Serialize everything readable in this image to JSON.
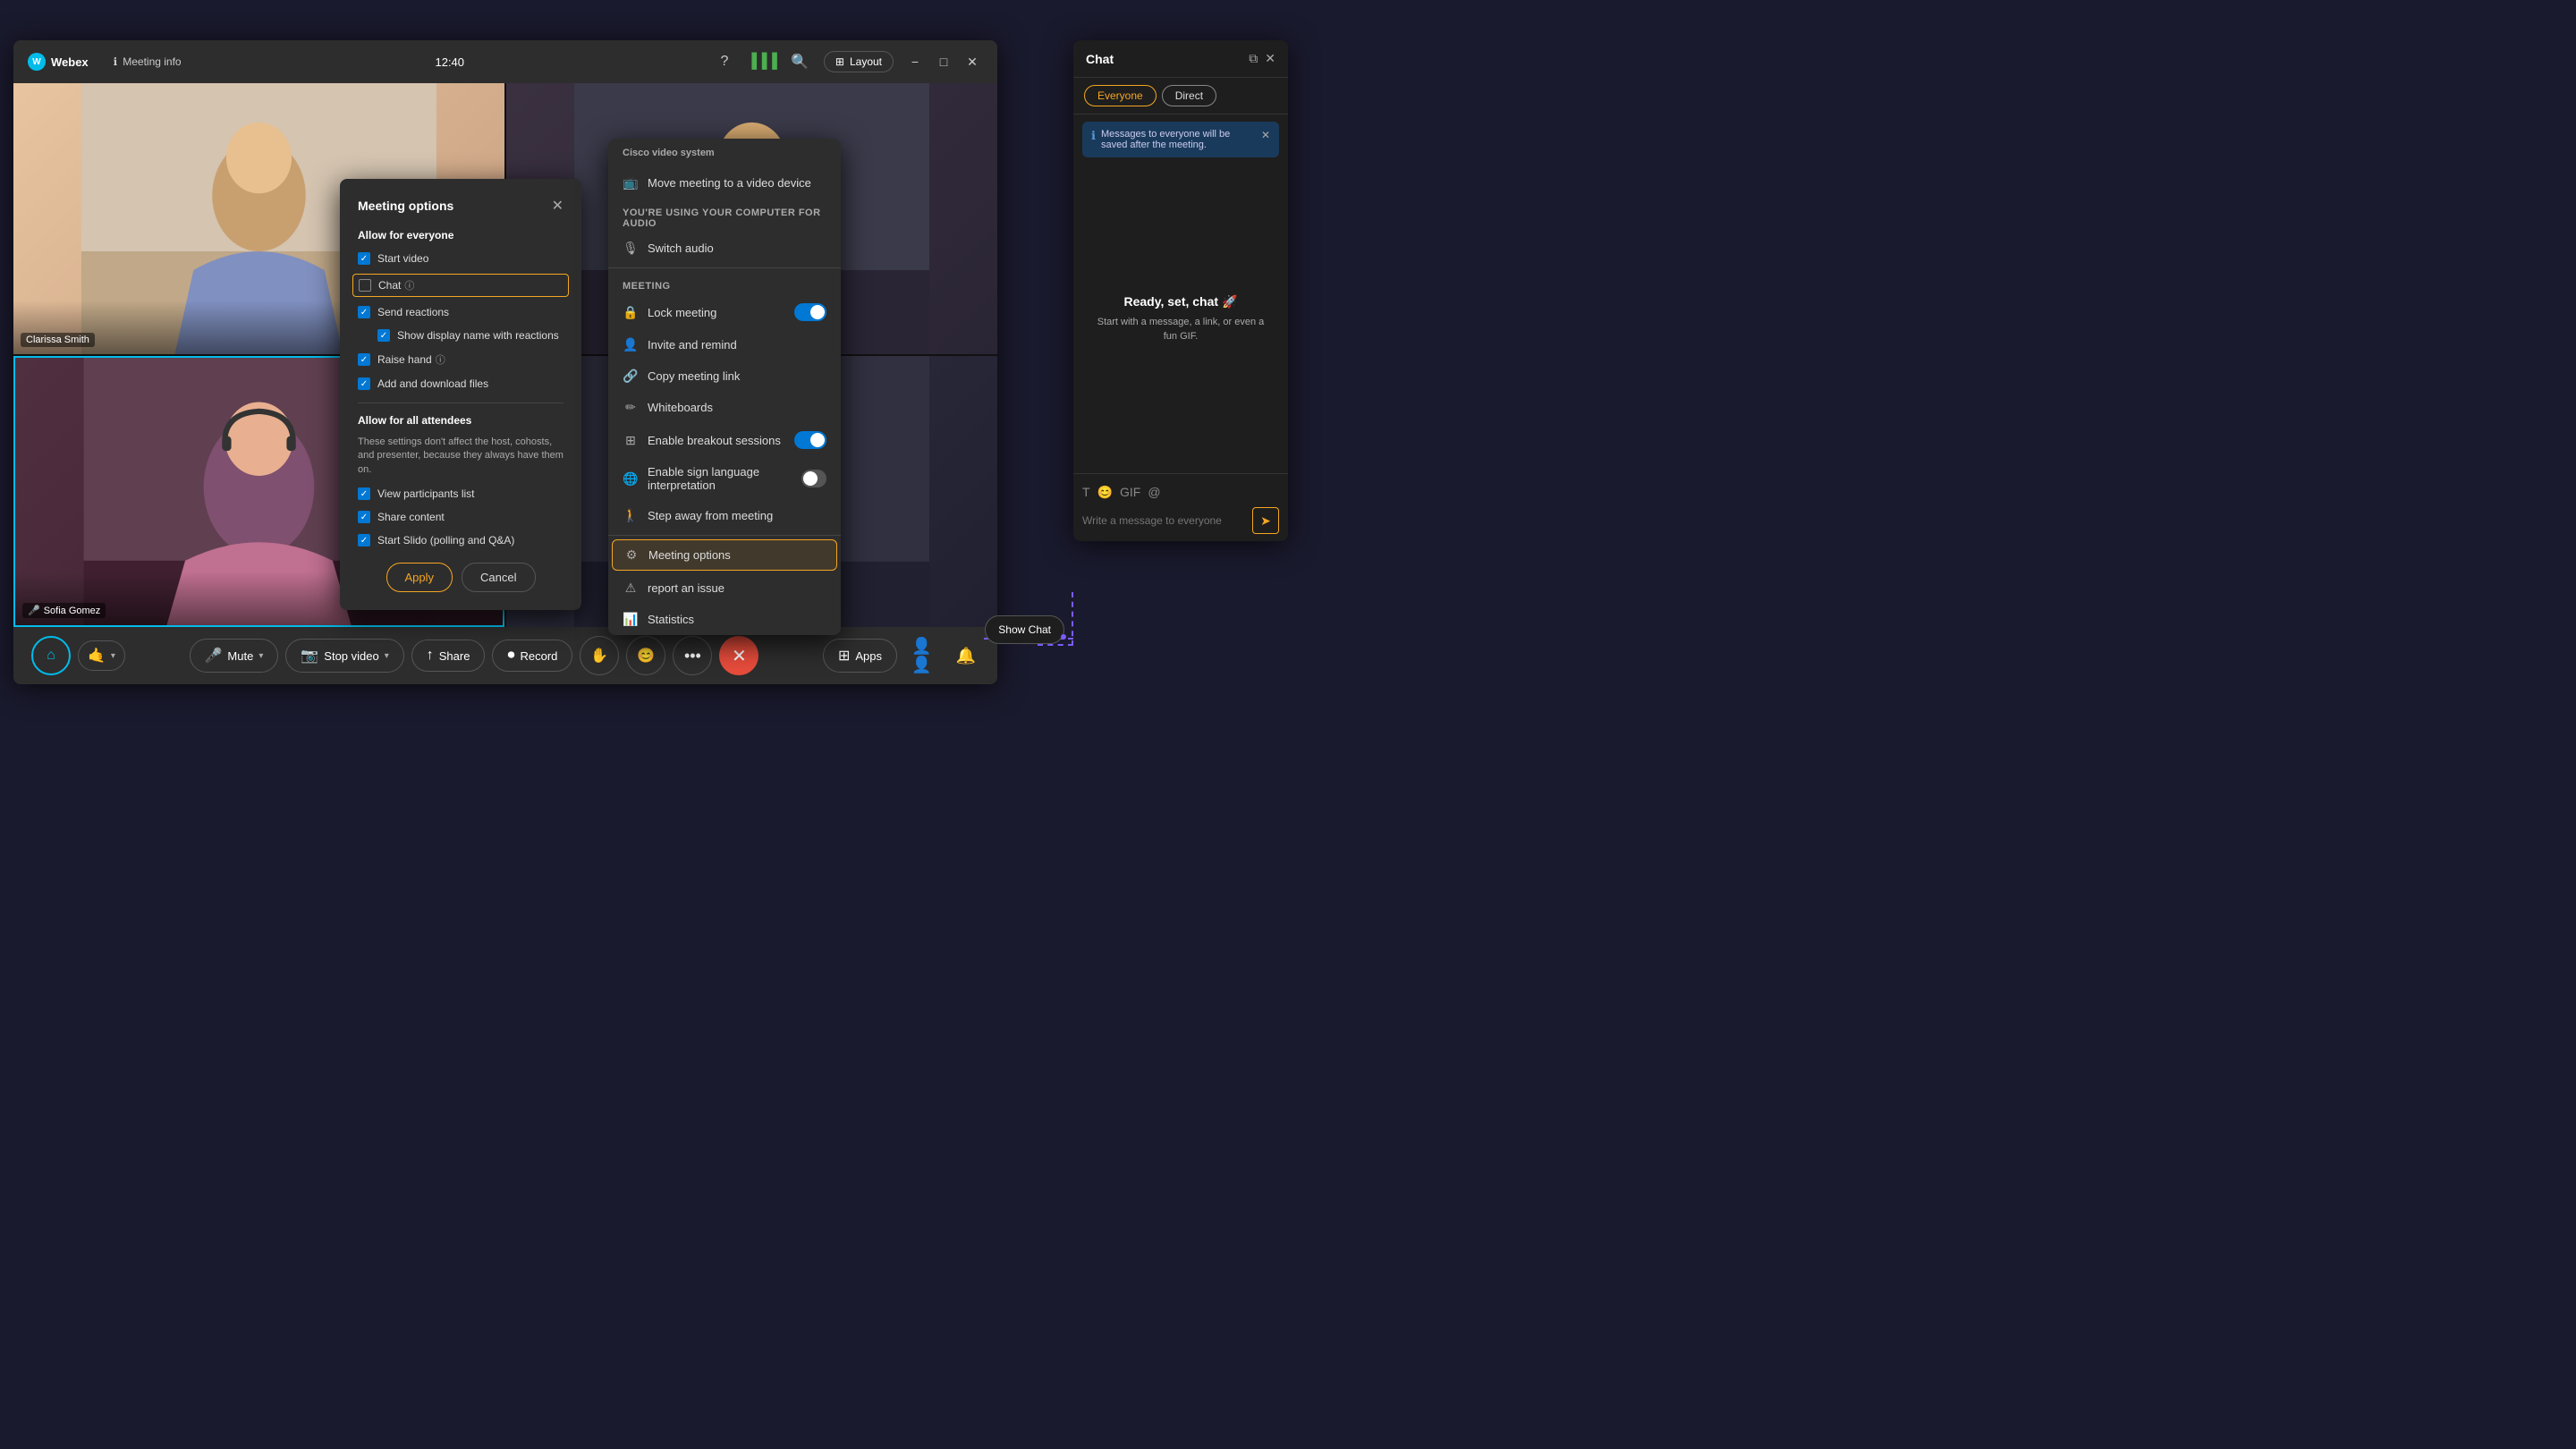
{
  "app": {
    "name": "Webex",
    "title": "Webex",
    "meeting_info": "Meeting info"
  },
  "titlebar": {
    "time": "12:40",
    "layout_label": "Layout"
  },
  "participants": [
    {
      "name": "Clarissa Smith",
      "has_mic": false
    },
    {
      "name": "",
      "has_mic": false
    },
    {
      "name": "Sofia Gomez",
      "has_mic": true
    },
    {
      "name": "",
      "has_mic": false
    }
  ],
  "meeting_options": {
    "title": "Meeting options",
    "allow_for_everyone_label": "Allow for everyone",
    "start_video_label": "Start video",
    "chat_label": "Chat",
    "send_reactions_label": "Send reactions",
    "show_display_name_label": "Show display name with reactions",
    "raise_hand_label": "Raise hand",
    "add_download_label": "Add and download files",
    "allow_for_attendees_label": "Allow for all attendees",
    "allow_attendees_desc": "These settings don't affect the host, cohosts, and presenter, because they always have them on.",
    "view_participants_label": "View participants list",
    "share_content_label": "Share content",
    "start_slido_label": "Start Slido (polling and Q&A)",
    "apply_label": "Apply",
    "cancel_label": "Cancel"
  },
  "more_menu": {
    "cisco_header": "Cisco video system",
    "move_meeting": "Move meeting to a video device",
    "audio_section": "You're using your computer for audio",
    "switch_audio": "Switch audio",
    "meeting_section": "Meeting",
    "lock_meeting": "Lock meeting",
    "invite_remind": "Invite and remind",
    "copy_link": "Copy meeting link",
    "whiteboards": "Whiteboards",
    "enable_breakout": "Enable breakout sessions",
    "enable_sign": "Enable sign language interpretation",
    "step_away": "Step away from meeting",
    "meeting_options": "Meeting options",
    "report_issue": "report an issue",
    "statistics": "Statistics"
  },
  "toolbar": {
    "mute_label": "Mute",
    "stop_video_label": "Stop video",
    "share_label": "Share",
    "record_label": "Record",
    "raise_hand_label": "✋",
    "reactions_label": "😊",
    "apps_label": "Apps",
    "participants_icon": "👤",
    "notifications_icon": "🔔"
  },
  "chat": {
    "title": "Chat",
    "tab_everyone": "Everyone",
    "tab_direct": "Direct",
    "info_banner": "Messages to everyone will be saved after the meeting.",
    "ready_title": "Ready, set, chat",
    "ready_emoji": "🚀",
    "ready_desc": "Start with a message, a link, or even a fun GIF.",
    "input_placeholder": "Write a message to everyone",
    "toolbar": {
      "format": "T",
      "emoji": "😊",
      "gif": "GIF",
      "mention": "@"
    }
  },
  "show_chat_btn": "Show Chat",
  "colors": {
    "accent": "#f5a623",
    "blue": "#0078d4",
    "teal": "#00bceb",
    "red": "#e74c3c",
    "purple": "#7b5cf8"
  }
}
